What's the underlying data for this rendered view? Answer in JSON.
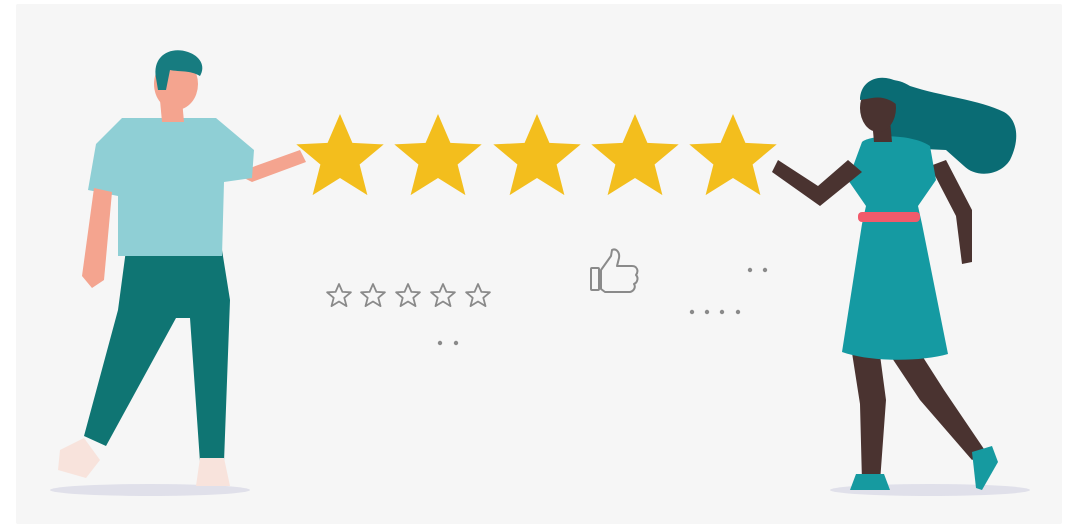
{
  "illustration": {
    "subject": "five-star-rating",
    "rating": {
      "filled_stars": 5,
      "total_stars": 5
    },
    "outline_rating": {
      "total_stars": 5
    },
    "colors": {
      "background": "#f6f6f6",
      "star_gold": "#f3be1d",
      "man_shirt": "#8fcfd5",
      "man_pants": "#0f7573",
      "man_hair": "#177c80",
      "man_skin": "#f4a48f",
      "woman_dress": "#159aa2",
      "woman_hair": "#0a6c74",
      "woman_belt": "#f15a6b",
      "woman_skin": "#4a3330",
      "woman_shoes": "#169aa0",
      "outline_gray": "#8a8a8a",
      "floor_shadow": "#e0e0ea"
    },
    "icons": [
      "thumbs-up-icon",
      "star-outline-icon",
      "star-filled-icon"
    ]
  }
}
